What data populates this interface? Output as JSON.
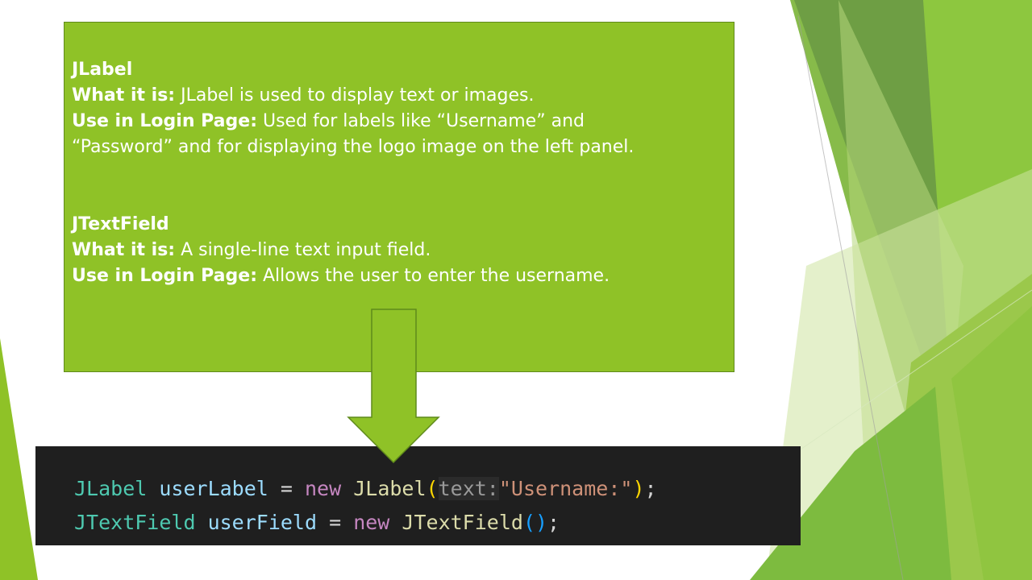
{
  "slide": {
    "section1": {
      "heading": "JLabel",
      "what_label": "What it is:",
      "what_text": " JLabel is used to display text or images.",
      "use_label": "Use in Login Page:",
      "use_text_line1": " Used for labels like “Username” and",
      "use_text_line2": "“Password” and for displaying the logo image on the left panel."
    },
    "section2": {
      "heading": "JTextField",
      "what_label": "What it is:",
      "what_text": " A single-line text input field.",
      "use_label": "Use in Login Page:",
      "use_text": " Allows the user to enter the username."
    }
  },
  "code": {
    "line1": {
      "type": "JLabel",
      "var": "userLabel",
      "eq": " = ",
      "kw": "new",
      "ctor": "JLabel",
      "open": "(",
      "hint": "text:",
      "str": "\"Username:\"",
      "close": ")",
      "semi": ";"
    },
    "line2": {
      "type": "JTextField",
      "var": "userField",
      "eq": " = ",
      "kw": "new",
      "ctor": "JTextField",
      "parens": "()",
      "semi": ";"
    }
  },
  "colors": {
    "box_green": "#8fc227",
    "code_bg": "#1f1f1f",
    "accent_dark_green": "#4c8f25"
  }
}
